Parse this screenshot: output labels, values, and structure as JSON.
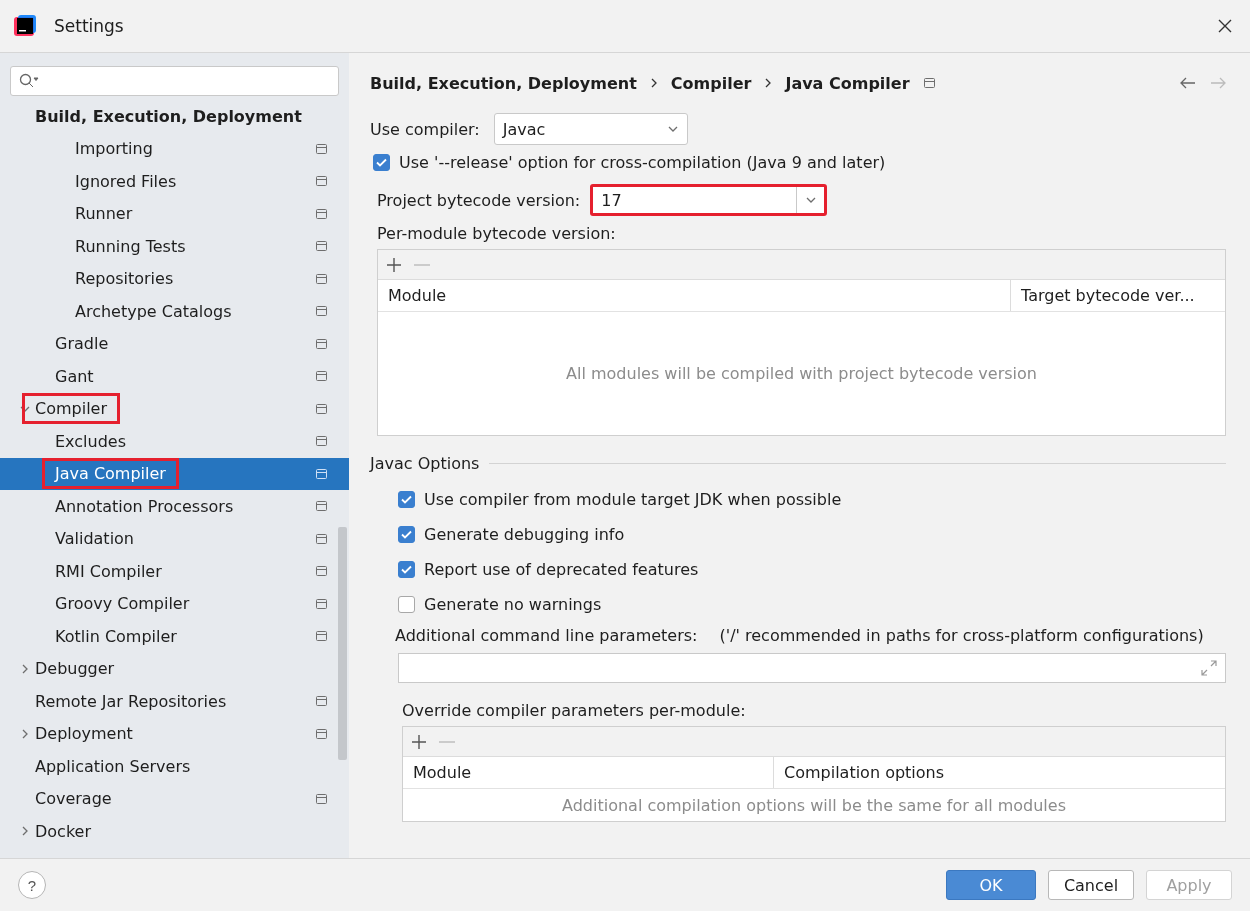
{
  "window": {
    "title": "Settings"
  },
  "sidebar": {
    "heading": "Build, Execution, Deployment",
    "items": [
      {
        "children": [
          {
            "children": [
              {
                "label": "Importing",
                "project_scope": true,
                "selected": false,
                "highlighted": false
              },
              {
                "label": "Ignored Files",
                "project_scope": true,
                "selected": false,
                "highlighted": false
              },
              {
                "label": "Runner",
                "project_scope": true,
                "selected": false,
                "highlighted": false
              },
              {
                "label": "Running Tests",
                "project_scope": true,
                "selected": false,
                "highlighted": false
              },
              {
                "label": "Repositories",
                "project_scope": true,
                "selected": false,
                "highlighted": false
              },
              {
                "label": "Archetype Catalogs",
                "project_scope": true,
                "selected": false,
                "highlighted": false
              }
            ]
          },
          {
            "label": "Gradle",
            "project_scope": true,
            "selected": false,
            "highlighted": false
          },
          {
            "label": "Gant",
            "project_scope": true,
            "selected": false,
            "highlighted": false
          }
        ]
      },
      {
        "label": "Compiler",
        "project_scope": true,
        "selected": false,
        "highlighted": true,
        "expanded": true,
        "children": [
          {
            "label": "Excludes",
            "project_scope": true,
            "selected": false,
            "highlighted": false
          },
          {
            "label": "Java Compiler",
            "project_scope": true,
            "selected": true,
            "highlighted": true
          },
          {
            "label": "Annotation Processors",
            "project_scope": true,
            "selected": false,
            "highlighted": false
          },
          {
            "label": "Validation",
            "project_scope": true,
            "selected": false,
            "highlighted": false
          },
          {
            "label": "RMI Compiler",
            "project_scope": true,
            "selected": false,
            "highlighted": false
          },
          {
            "label": "Groovy Compiler",
            "project_scope": true,
            "selected": false,
            "highlighted": false
          },
          {
            "label": "Kotlin Compiler",
            "project_scope": true,
            "selected": false,
            "highlighted": false
          }
        ]
      },
      {
        "label": "Debugger",
        "project_scope": false,
        "selected": false,
        "highlighted": false,
        "expanded": false
      },
      {
        "label": "Remote Jar Repositories",
        "project_scope": true,
        "selected": false,
        "highlighted": false
      },
      {
        "label": "Deployment",
        "project_scope": true,
        "selected": false,
        "highlighted": false,
        "expanded": false
      },
      {
        "label": "Application Servers",
        "project_scope": false,
        "selected": false,
        "highlighted": false
      },
      {
        "label": "Coverage",
        "project_scope": true,
        "selected": false,
        "highlighted": false
      },
      {
        "label": "Docker",
        "project_scope": false,
        "selected": false,
        "highlighted": false,
        "expanded": false
      }
    ]
  },
  "breadcrumb": [
    "Build, Execution, Deployment",
    "Compiler",
    "Java Compiler"
  ],
  "use_compiler": {
    "label": "Use compiler:",
    "value": "Javac"
  },
  "release_option": {
    "label": "Use '--release' option for cross-compilation (Java 9 and later)",
    "checked": true
  },
  "project_bytecode": {
    "label": "Project bytecode version:",
    "value": "17",
    "highlighted": true
  },
  "per_module": {
    "label": "Per-module bytecode version:",
    "columns": [
      "Module",
      "Target bytecode ver..."
    ],
    "empty_text": "All modules will be compiled with project bytecode version"
  },
  "javac_options": {
    "title": "Javac Options",
    "options": [
      {
        "label": "Use compiler from module target JDK when possible",
        "checked": true
      },
      {
        "label": "Generate debugging info",
        "checked": true
      },
      {
        "label": "Report use of deprecated features",
        "checked": true
      },
      {
        "label": "Generate no warnings",
        "checked": false
      }
    ],
    "params": {
      "label": "Additional command line parameters:",
      "hint": "('/' recommended in paths for cross-platform configurations)"
    },
    "override": {
      "label": "Override compiler parameters per-module:",
      "columns": [
        "Module",
        "Compilation options"
      ],
      "empty_text": "Additional compilation options will be the same for all modules"
    }
  },
  "footer": {
    "help": "?",
    "buttons": [
      {
        "label": "OK",
        "kind": "primary",
        "disabled": false
      },
      {
        "label": "Cancel",
        "kind": "normal",
        "disabled": false
      },
      {
        "label": "Apply",
        "kind": "normal",
        "disabled": true
      }
    ]
  }
}
